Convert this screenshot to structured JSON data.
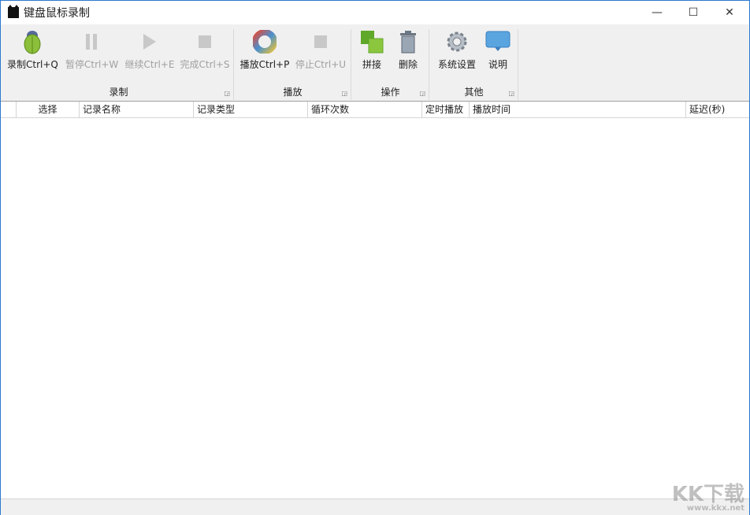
{
  "window": {
    "title": "键盘鼠标录制",
    "minimize": "—",
    "maximize": "☐",
    "close": "✕"
  },
  "ribbon": {
    "groups": [
      {
        "label": "录制",
        "buttons": [
          {
            "label": "录制Ctrl+Q",
            "icon": "bug-icon",
            "enabled": true
          },
          {
            "label": "暂停Ctrl+W",
            "icon": "pause-icon",
            "enabled": false
          },
          {
            "label": "继续Ctrl+E",
            "icon": "play-icon",
            "enabled": false
          },
          {
            "label": "完成Ctrl+S",
            "icon": "stop-icon",
            "enabled": false
          }
        ]
      },
      {
        "label": "播放",
        "buttons": [
          {
            "label": "播放Ctrl+P",
            "icon": "color-wheel-icon",
            "enabled": true
          },
          {
            "label": "停止Ctrl+U",
            "icon": "stop-icon",
            "enabled": false
          }
        ]
      },
      {
        "label": "操作",
        "buttons": [
          {
            "label": "拼接",
            "icon": "merge-icon",
            "enabled": true
          },
          {
            "label": "删除",
            "icon": "trash-icon",
            "enabled": true
          }
        ]
      },
      {
        "label": "其他",
        "buttons": [
          {
            "label": "系统设置",
            "icon": "gear-icon",
            "enabled": true
          },
          {
            "label": "说明",
            "icon": "speech-bubble-icon",
            "enabled": true
          }
        ]
      }
    ]
  },
  "table": {
    "columns": [
      "",
      "选择",
      "记录名称",
      "记录类型",
      "循环次数",
      "定时播放",
      "播放时间",
      "延迟(秒)"
    ],
    "rows": []
  },
  "watermark": {
    "text": "KK下载",
    "url": "www.kkx.net"
  }
}
